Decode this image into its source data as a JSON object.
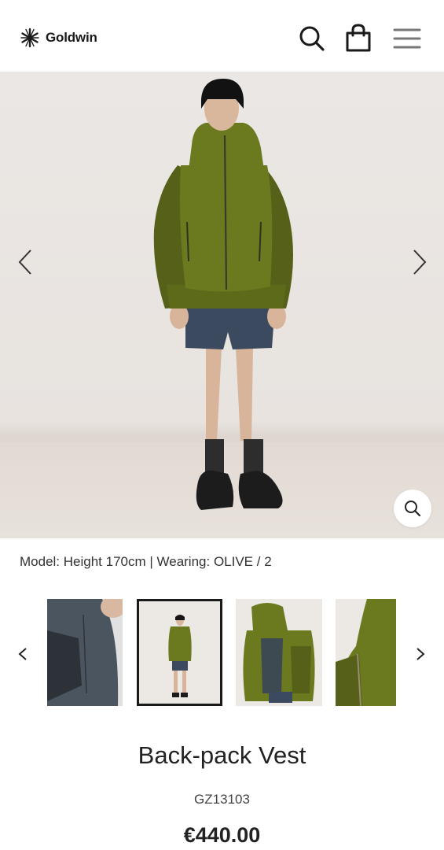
{
  "brand": {
    "name": "Goldwin"
  },
  "header": {
    "icons": [
      "search-icon",
      "shopping-bag-icon",
      "hamburger-menu-icon"
    ]
  },
  "gallery": {
    "caption": "Model: Height 170cm | Wearing: OLIVE / 2",
    "thumbnails": [
      "detail-sleeve-grey",
      "full-front-olive",
      "back-view-olive",
      "hood-detail-olive"
    ],
    "selected_thumbnail": 2
  },
  "product": {
    "title": "Back-pack Vest",
    "code": "GZ13103",
    "price": "€440.00"
  },
  "colors": {
    "olive": "#6b7a1e",
    "olive_dark": "#566018",
    "shorts_navy": "#3b4a5e",
    "background": "#ebe7e4",
    "text": "#222222"
  }
}
